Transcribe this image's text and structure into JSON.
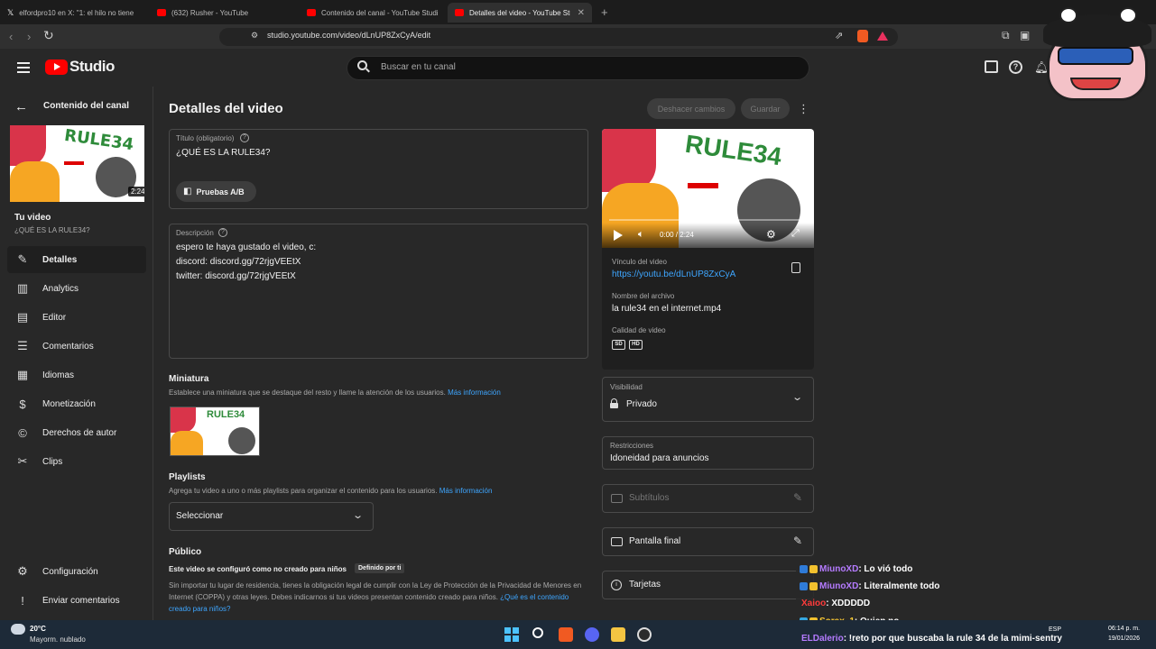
{
  "browser": {
    "tabs": [
      {
        "title": "elfordpro10 en X: \"1: el hilo no tiene"
      },
      {
        "title": "(632) Rusher - YouTube"
      },
      {
        "title": "Contenido del canal - YouTube Studi"
      },
      {
        "title": "Detalles del video - YouTube Stu"
      }
    ],
    "new_tab": "+",
    "url": "studio.youtube.com/video/dLnUP8ZxCyA/edit"
  },
  "header": {
    "logo_text": "Studio",
    "search_placeholder": "Buscar en tu canal"
  },
  "sidebar": {
    "back_label": "Contenido del canal",
    "thumb_duration": "2:24",
    "your_video_label": "Tu video",
    "video_title": "¿QUÉ ES LA RULE34?",
    "items": [
      {
        "label": "Detalles",
        "icon": "pencil-icon"
      },
      {
        "label": "Analytics",
        "icon": "analytics-icon"
      },
      {
        "label": "Editor",
        "icon": "editor-icon"
      },
      {
        "label": "Comentarios",
        "icon": "comments-icon"
      },
      {
        "label": "Idiomas",
        "icon": "languages-icon"
      },
      {
        "label": "Monetización",
        "icon": "dollar-icon"
      },
      {
        "label": "Derechos de autor",
        "icon": "copyright-icon"
      },
      {
        "label": "Clips",
        "icon": "scissors-icon"
      }
    ],
    "settings_label": "Configuración",
    "feedback_label": "Enviar comentarios"
  },
  "main": {
    "page_title": "Detalles del video",
    "undo_label": "Deshacer cambios",
    "save_label": "Guardar",
    "title_field": {
      "label": "Título (obligatorio)",
      "value": "¿QUÉ ES LA RULE34?",
      "ab_label": "Pruebas A/B"
    },
    "description_field": {
      "label": "Descripción",
      "lines": [
        "espero te haya gustado el video, c:",
        "discord: discord.gg/72rjgVEEtX",
        "twitter: discord.gg/72rjgVEEtX"
      ]
    },
    "thumbnail": {
      "heading": "Miniatura",
      "help": "Establece una miniatura que se destaque del resto y llame la atención de los usuarios.",
      "more": "Más información"
    },
    "playlists": {
      "heading": "Playlists",
      "help": "Agrega tu video a uno o más playlists para organizar el contenido para los usuarios.",
      "more": "Más información",
      "select_value": "Seleccionar"
    },
    "audience": {
      "heading": "Público",
      "configured": "Este video se configuró como no creado para niños",
      "badge": "Definido por ti",
      "help": "Sin importar tu lugar de residencia, tienes la obligación legal de cumplir con la Ley de Protección de la Privacidad de Menores en Internet (COPPA) y otras leyes. Debes indicarnos si tus videos presentan contenido creado para niños.",
      "link": "¿Qué es el contenido creado para niños?"
    }
  },
  "preview": {
    "time": "0:00 / 2:24",
    "link_label": "Vínculo del video",
    "link_value": "https://youtu.be/dLnUP8ZxCyA",
    "filename_label": "Nombre del archivo",
    "filename_value": "la rule34 en el internet.mp4",
    "quality_label": "Calidad de video",
    "quality_badges": [
      "SD",
      "HD"
    ]
  },
  "right_panel": {
    "visibility_label": "Visibilidad",
    "visibility_value": "Privado",
    "restrictions_label": "Restricciones",
    "restrictions_value": "Idoneidad para anuncios",
    "subtitles": "Subtítulos",
    "end_screen": "Pantalla final",
    "cards": "Tarjetas"
  },
  "chat": [
    {
      "user": "MiunoXD",
      "msg": ": Lo vió todo",
      "color": "#b57bff"
    },
    {
      "user": "MiunoXD",
      "msg": ": Literalmente todo",
      "color": "#b57bff"
    },
    {
      "user": "Xaioo",
      "msg": ": XDDDDD",
      "color": "#ff3b3b"
    },
    {
      "user": "Sorax_1",
      "msg": ": Quien no",
      "color": "#ffcc33"
    },
    {
      "user": "ELDalerio",
      "msg": ": !reto por que buscaba la rule 34 de la mimi-sentry",
      "color": "#b57bff"
    }
  ],
  "taskbar": {
    "weather_temp": "20°C",
    "weather_desc": "Mayorm. nublado",
    "lang": "ESP",
    "time": "06:14 p. m.",
    "date": "19/01/2026"
  },
  "colors": {
    "accent": "#3ea6ff",
    "youtube_red": "#ff0000",
    "bg": "#282828"
  }
}
